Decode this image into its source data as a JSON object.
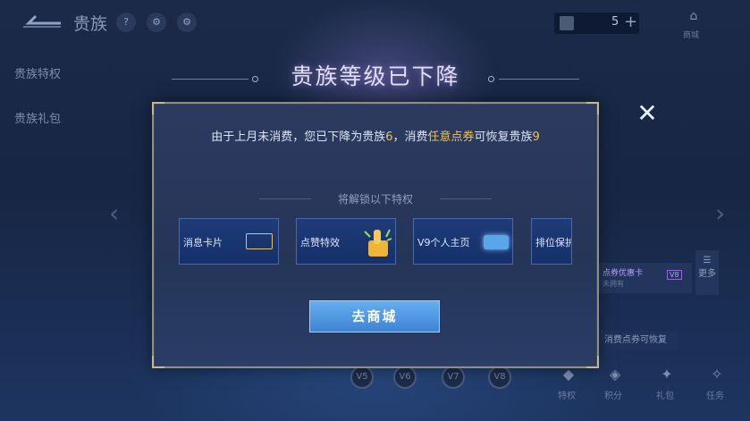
{
  "topbar": {
    "title": "贵族",
    "badges": [
      "?",
      "⚙",
      "⚙"
    ],
    "coin_value": "5",
    "plus": "+",
    "shop_label": "商城"
  },
  "left_nav": [
    "贵族特权",
    "贵族礼包"
  ],
  "dialog": {
    "title": "贵族等级已下降",
    "message_prefix": "由于上月未消费，您已下降为贵族",
    "current_level": "6",
    "message_mid": "，消费",
    "highlight": "任意点券",
    "message_suffix": "可恢复贵族",
    "restore_level": "9",
    "unlock_label": "将解锁以下特权",
    "privileges": [
      {
        "label": "消息卡片"
      },
      {
        "label": "点赞特效"
      },
      {
        "label": "V9个人主页"
      },
      {
        "label": "排位保护"
      }
    ],
    "shop_button": "去商城",
    "close_icon": "✕"
  },
  "background": {
    "card_title": "点券优惠卡",
    "card_sub": "未拥有",
    "card_tag": "V8",
    "more": "更多",
    "recover_pill": "消费点券可恢复",
    "levels": [
      "V5",
      "V6",
      "V7",
      "V8"
    ],
    "bottom_items": [
      "特权",
      "积分",
      "礼包",
      "任务"
    ]
  },
  "colors": {
    "highlight": "#f3c352",
    "button": "#4f98e2",
    "panel": "#2a3a5f"
  }
}
